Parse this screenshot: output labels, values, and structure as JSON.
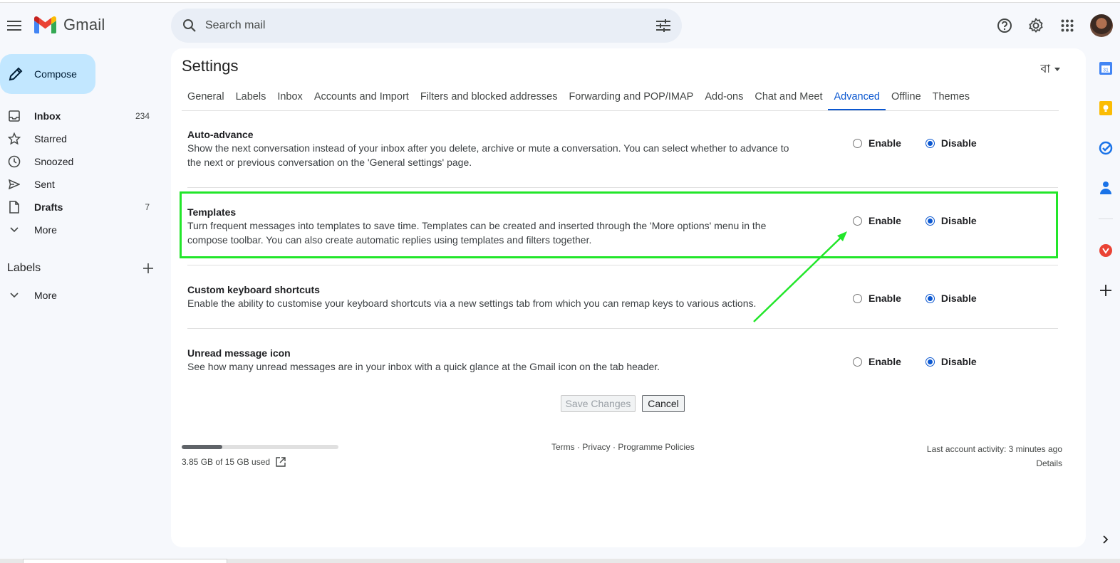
{
  "app": {
    "name": "Gmail"
  },
  "search": {
    "placeholder": "Search mail"
  },
  "compose": {
    "label": "Compose"
  },
  "nav": {
    "items": [
      {
        "label": "Inbox",
        "count": "234"
      },
      {
        "label": "Starred",
        "count": ""
      },
      {
        "label": "Snoozed",
        "count": ""
      },
      {
        "label": "Sent",
        "count": ""
      },
      {
        "label": "Drafts",
        "count": "7"
      },
      {
        "label": "More",
        "count": ""
      }
    ]
  },
  "labels": {
    "title": "Labels",
    "more": "More"
  },
  "settings": {
    "title": "Settings",
    "language": "বা",
    "tabs": [
      "General",
      "Labels",
      "Inbox",
      "Accounts and Import",
      "Filters and blocked addresses",
      "Forwarding and POP/IMAP",
      "Add-ons",
      "Chat and Meet",
      "Advanced",
      "Offline",
      "Themes"
    ],
    "active_tab": "Advanced",
    "rows": [
      {
        "title": "Auto-advance",
        "desc": "Show the next conversation instead of your inbox after you delete, archive or mute a conversation. You can select whether to advance to the next or previous conversation on the 'General settings' page.",
        "enable": "Enable",
        "disable": "Disable",
        "selected": "Disable"
      },
      {
        "title": "Templates",
        "desc": "Turn frequent messages into templates to save time. Templates can be created and inserted through the 'More options' menu in the compose toolbar. You can also create automatic replies using templates and filters together.",
        "enable": "Enable",
        "disable": "Disable",
        "selected": "Disable"
      },
      {
        "title": "Custom keyboard shortcuts",
        "desc": "Enable the ability to customise your keyboard shortcuts via a new settings tab from which you can remap keys to various actions.",
        "enable": "Enable",
        "disable": "Disable",
        "selected": "Disable"
      },
      {
        "title": "Unread message icon",
        "desc": "See how many unread messages are in your inbox with a quick glance at the Gmail icon on the tab header.",
        "enable": "Enable",
        "disable": "Disable",
        "selected": "Disable"
      }
    ],
    "save_label": "Save Changes",
    "cancel_label": "Cancel"
  },
  "footer": {
    "storage_text": "3.85 GB of 15 GB used",
    "storage_fraction": 0.257,
    "terms": "Terms",
    "privacy": "Privacy",
    "policies": "Programme Policies",
    "sep": " · ",
    "activity": "Last account activity: 3 minutes ago",
    "details": "Details"
  },
  "colors": {
    "accent": "#0b57d0",
    "compose_bg": "#c2e7ff",
    "highlight": "#22e62a"
  }
}
